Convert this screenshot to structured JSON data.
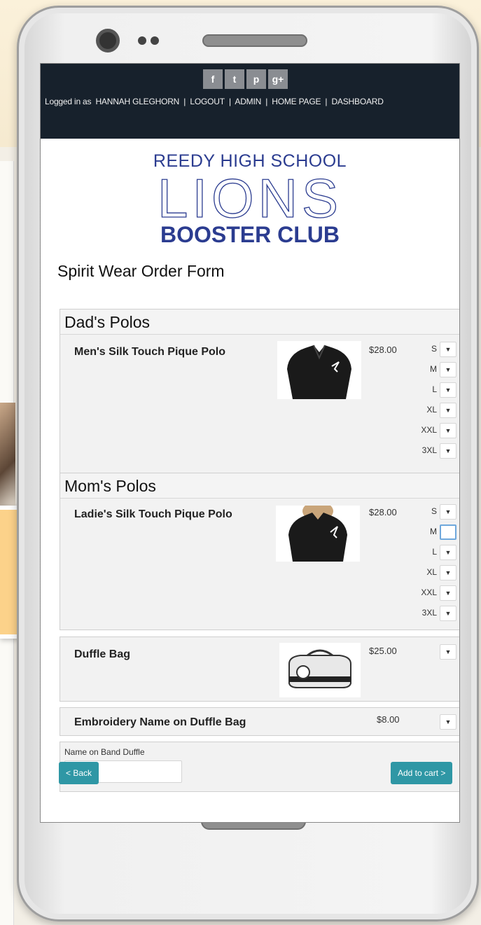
{
  "header": {
    "social": [
      {
        "glyph": "f",
        "icon": "facebook-icon"
      },
      {
        "glyph": "t",
        "icon": "twitter-icon"
      },
      {
        "glyph": "p",
        "icon": "pinterest-icon"
      },
      {
        "glyph": "g+",
        "icon": "google-plus-icon"
      }
    ],
    "logged_in_label": "Logged in as",
    "user_name": "HANNAH GLEGHORN",
    "sep": "|",
    "logout": "LOGOUT",
    "admin": "ADMIN",
    "home_page": "HOME PAGE",
    "dashboard": "DASHBOARD"
  },
  "logo": {
    "school": "REEDY HIGH SCHOOL",
    "mascot": "LIONS",
    "club": "BOOSTER CLUB"
  },
  "form_title": "Spirit Wear Order Form",
  "groups": [
    {
      "title": "Dad's Polos",
      "product": "Men's Silk Touch Pique Polo",
      "price": "$28.00",
      "sizes": [
        "S",
        "M",
        "L",
        "XL",
        "XXL",
        "3XL"
      ]
    },
    {
      "title": "Mom's Polos",
      "product": "Ladie's Silk Touch Pique Polo",
      "price": "$28.00",
      "sizes": [
        "S",
        "M",
        "L",
        "XL",
        "XXL",
        "3XL"
      ]
    }
  ],
  "duffle": {
    "product": "Duffle Bag",
    "price": "$25.00"
  },
  "embroidery": {
    "product": "Embroidery Name on Duffle Bag",
    "price": "$8.00"
  },
  "name_field": {
    "label": "Name on Band Duffle",
    "value": ""
  },
  "buttons": {
    "back": "< Back",
    "add_to_cart": "Add to cart >"
  },
  "select_arrow": "▼",
  "colors": {
    "brand_blue": "#2b3c90",
    "topbar": "#17212c",
    "button": "#2f97a5"
  }
}
